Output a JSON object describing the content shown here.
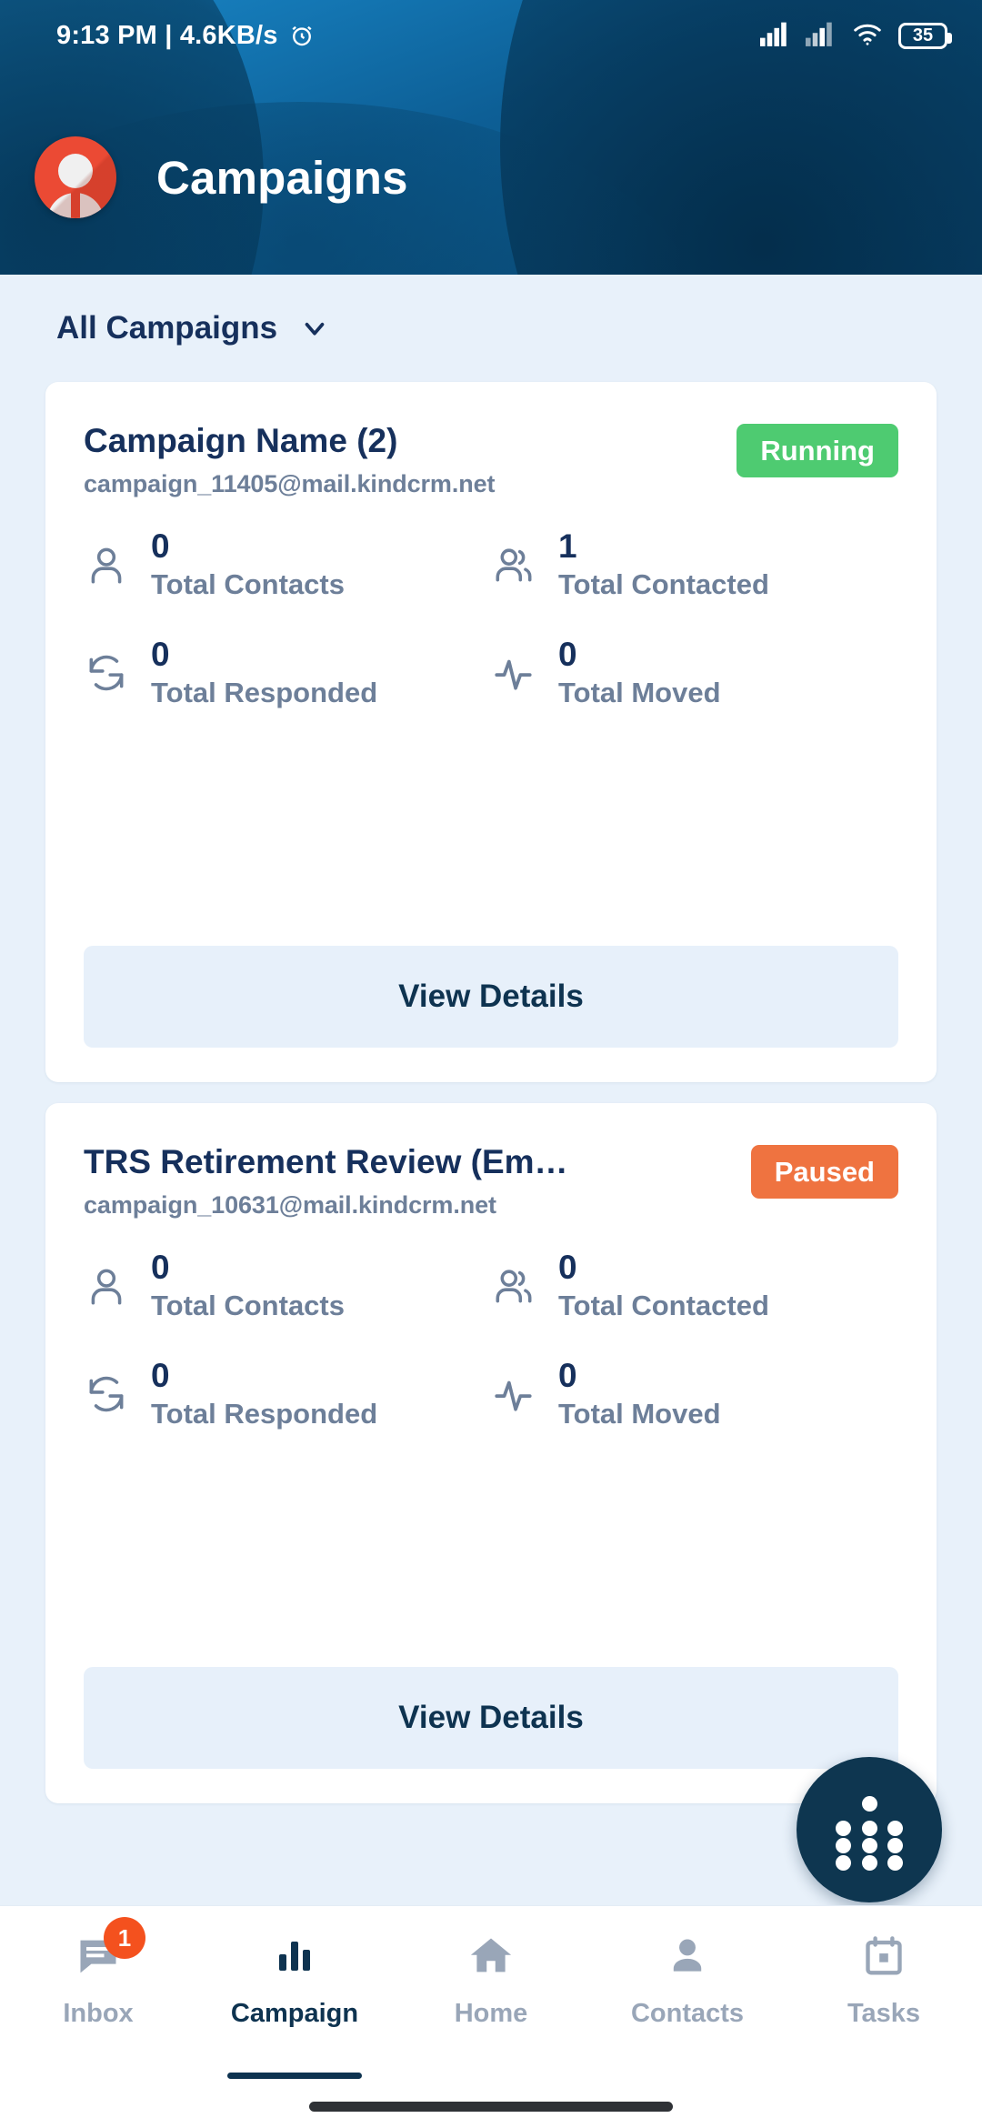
{
  "status_bar": {
    "time": "9:13 PM",
    "separator": " | ",
    "network_speed": "4.6KB/s",
    "alarm_icon": "alarm-clock-icon",
    "signal_icon_1": "cellular-signal-icon",
    "signal_icon_2": "cellular-signal-icon",
    "wifi_icon": "wifi-icon",
    "battery_level": "35"
  },
  "header": {
    "title": "Campaigns",
    "avatar_icon": "user-avatar-icon",
    "avatar_color": "#eb4a34",
    "background_color": "#0b5586"
  },
  "filter": {
    "label": "All Campaigns",
    "chevron_icon": "chevron-down-icon"
  },
  "campaigns": [
    {
      "name": "Campaign Name (2)",
      "email": "campaign_11405@mail.kindcrm.net",
      "status": "Running",
      "status_color": "#4ecb71",
      "stats": [
        {
          "icon": "person-icon",
          "value": "0",
          "label": "Total Contacts"
        },
        {
          "icon": "people-icon",
          "value": "1",
          "label": "Total Contacted"
        },
        {
          "icon": "refresh-icon",
          "value": "0",
          "label": "Total Responded"
        },
        {
          "icon": "activity-icon",
          "value": "0",
          "label": "Total Moved"
        }
      ],
      "action_label": "View Details"
    },
    {
      "name": "TRS Retirement Review (Em…",
      "email": "campaign_10631@mail.kindcrm.net",
      "status": "Paused",
      "status_color": "#ef7340",
      "stats": [
        {
          "icon": "person-icon",
          "value": "0",
          "label": "Total Contacts"
        },
        {
          "icon": "people-icon",
          "value": "0",
          "label": "Total Contacted"
        },
        {
          "icon": "refresh-icon",
          "value": "0",
          "label": "Total Responded"
        },
        {
          "icon": "activity-icon",
          "value": "0",
          "label": "Total Moved"
        }
      ],
      "action_label": "View Details"
    }
  ],
  "fab": {
    "icon": "dot-grid-icon",
    "color": "#0e3650"
  },
  "bottom_nav": {
    "items": [
      {
        "label": "Inbox",
        "icon": "chat-message-icon",
        "badge": "1",
        "active": false
      },
      {
        "label": "Campaign",
        "icon": "bar-chart-icon",
        "badge": "",
        "active": true
      },
      {
        "label": "Home",
        "icon": "home-icon",
        "badge": "",
        "active": false
      },
      {
        "label": "Contacts",
        "icon": "person-icon",
        "badge": "",
        "active": false
      },
      {
        "label": "Tasks",
        "icon": "calendar-icon",
        "badge": "",
        "active": false
      }
    ],
    "active_color": "#0e3350",
    "inactive_color": "#99a6b8",
    "badge_color": "#f4511e"
  }
}
